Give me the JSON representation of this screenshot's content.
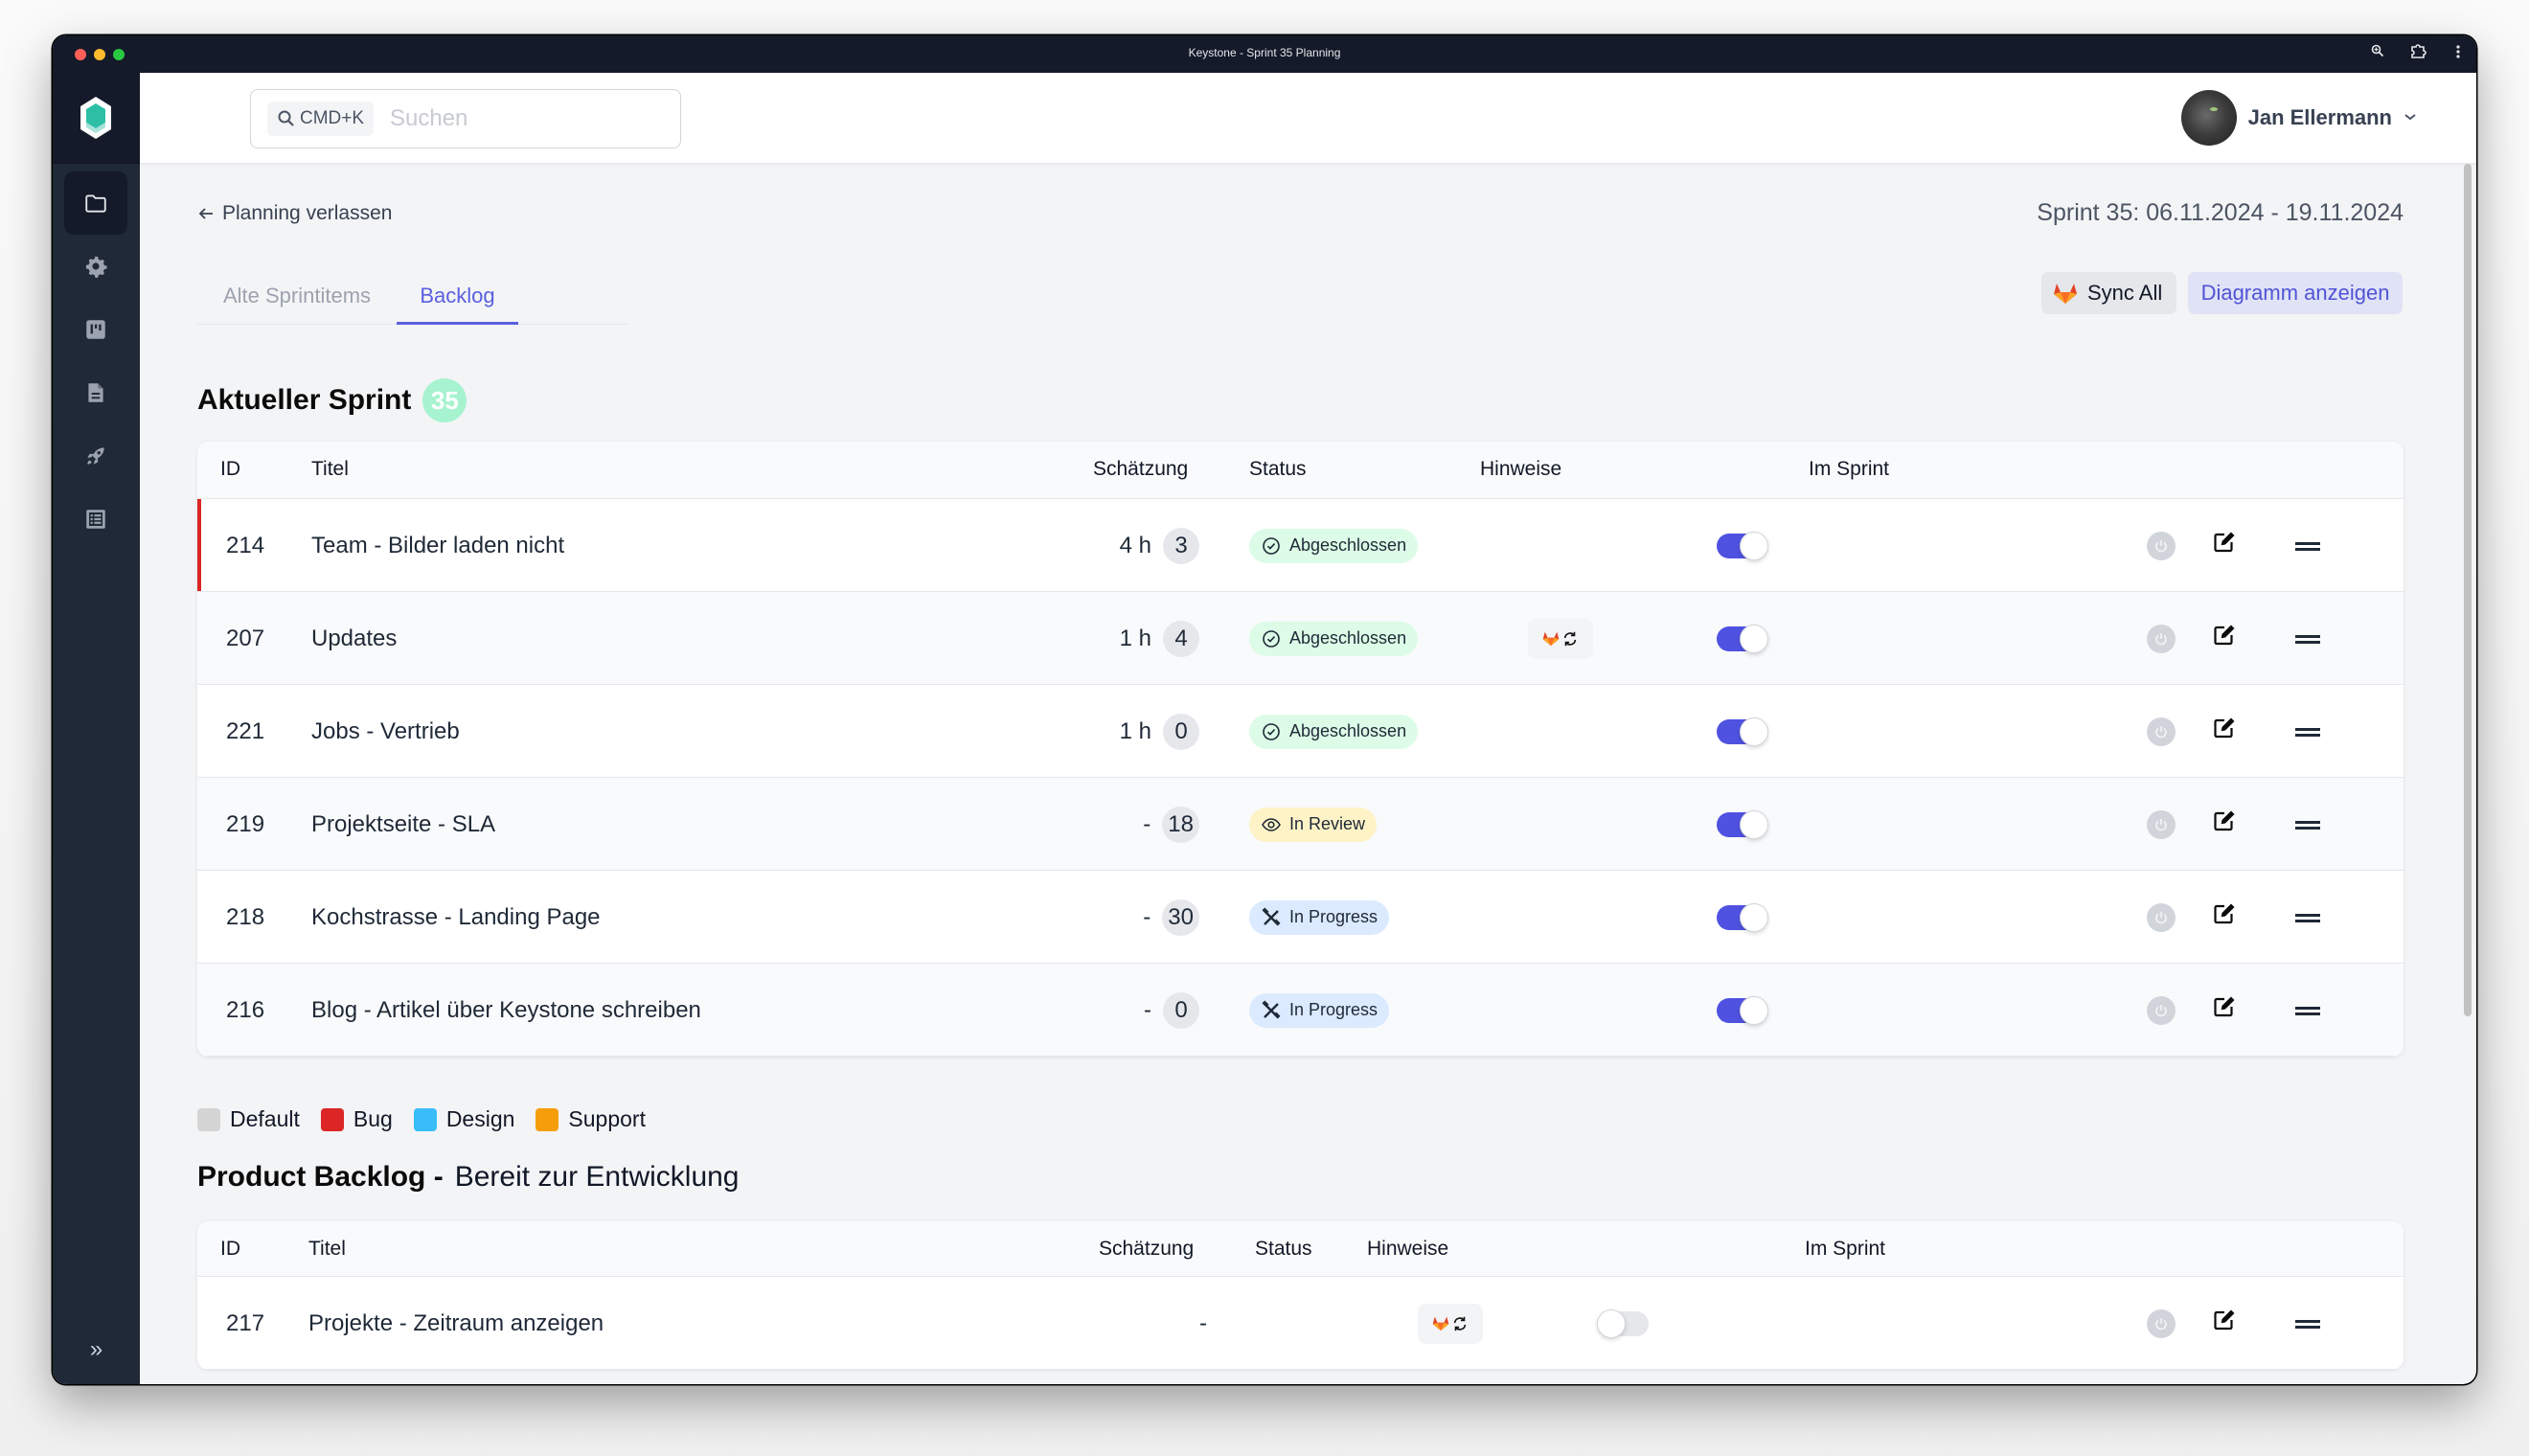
{
  "window": {
    "title": "Keystone - Sprint 35 Planning"
  },
  "sidebar": {
    "items": [
      {
        "icon": "folder-icon",
        "label": "Projekte",
        "active": true
      },
      {
        "icon": "gear-icon",
        "label": "Einstellungen",
        "active": false
      },
      {
        "icon": "board-icon",
        "label": "Board",
        "active": false
      },
      {
        "icon": "document-icon",
        "label": "Dokumente",
        "active": false
      },
      {
        "icon": "rocket-icon",
        "label": "Releases",
        "active": false
      },
      {
        "icon": "list-icon",
        "label": "Liste",
        "active": false
      }
    ],
    "expand_label": "»"
  },
  "header": {
    "search": {
      "shortcut": "CMD+K",
      "placeholder": "Suchen"
    },
    "user": {
      "name": "Jan Ellermann"
    }
  },
  "page": {
    "back_label": "Planning verlassen",
    "sprint_dates": "Sprint 35: 06.11.2024 - 19.11.2024",
    "tabs": [
      {
        "label": "Alte Sprintitems",
        "active": false
      },
      {
        "label": "Backlog",
        "active": true
      }
    ],
    "buttons": {
      "sync_all": "Sync All",
      "show_chart": "Diagramm anzeigen"
    }
  },
  "current_sprint": {
    "title": "Aktueller Sprint",
    "number": "35",
    "columns": {
      "id": "ID",
      "title": "Titel",
      "estimate": "Schätzung",
      "status": "Status",
      "hints": "Hinweise",
      "in_sprint": "Im Sprint"
    },
    "rows": [
      {
        "id": "214",
        "title": "Team - Bilder laden nicht",
        "hours": "4 h",
        "points": "3",
        "status": "Abgeschlossen",
        "status_type": "done",
        "hint": false,
        "in_sprint": true,
        "category": "Bug"
      },
      {
        "id": "207",
        "title": "Updates",
        "hours": "1 h",
        "points": "4",
        "status": "Abgeschlossen",
        "status_type": "done",
        "hint": true,
        "in_sprint": true,
        "category": "Default"
      },
      {
        "id": "221",
        "title": "Jobs - Vertrieb",
        "hours": "1 h",
        "points": "0",
        "status": "Abgeschlossen",
        "status_type": "done",
        "hint": false,
        "in_sprint": true,
        "category": "Default"
      },
      {
        "id": "219",
        "title": "Projektseite - SLA",
        "hours": "-",
        "points": "18",
        "status": "In Review",
        "status_type": "review",
        "hint": false,
        "in_sprint": true,
        "category": "Default"
      },
      {
        "id": "218",
        "title": "Kochstrasse - Landing Page",
        "hours": "-",
        "points": "30",
        "status": "In Progress",
        "status_type": "progress",
        "hint": false,
        "in_sprint": true,
        "category": "Default"
      },
      {
        "id": "216",
        "title": "Blog - Artikel über Keystone schreiben",
        "hours": "-",
        "points": "0",
        "status": "In Progress",
        "status_type": "progress",
        "hint": false,
        "in_sprint": true,
        "category": "Default"
      }
    ]
  },
  "legend": [
    {
      "label": "Default",
      "color": "#d4d4d4"
    },
    {
      "label": "Bug",
      "color": "#dc2626"
    },
    {
      "label": "Design",
      "color": "#38bdf8"
    },
    {
      "label": "Support",
      "color": "#f59e0b"
    }
  ],
  "product_backlog": {
    "title": "Product Backlog -",
    "subtitle": "Bereit zur Entwicklung",
    "columns": {
      "id": "ID",
      "title": "Titel",
      "estimate": "Schätzung",
      "status": "Status",
      "hints": "Hinweise",
      "in_sprint": "Im Sprint"
    },
    "rows": [
      {
        "id": "217",
        "title": "Projekte - Zeitraum anzeigen",
        "hours": "-",
        "points": "",
        "status": "",
        "hint": true,
        "in_sprint": false
      }
    ]
  },
  "colors": {
    "accent": "#5a5fe0",
    "toggle_on": "#4f52e0",
    "sidebar_bg": "#1f2937",
    "titlebar_bg": "#141a29",
    "bug": "#dc2626"
  }
}
